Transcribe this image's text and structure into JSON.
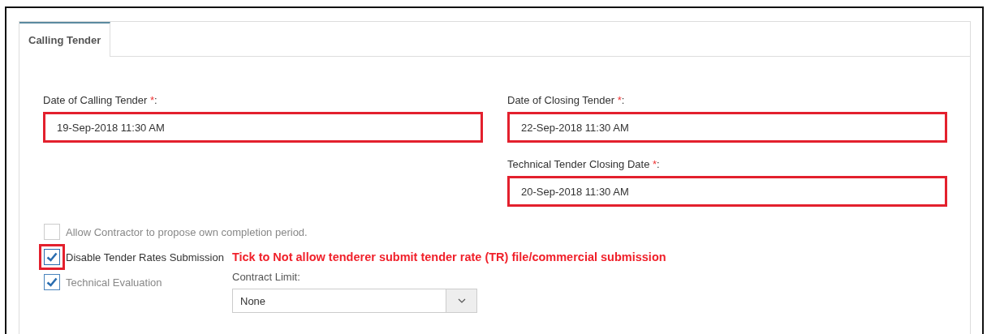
{
  "tabs": [
    {
      "label": "Calling Tender",
      "selected": true
    }
  ],
  "fields": [
    {
      "label": "Date of Calling Tender",
      "required_mark": "*",
      "suffix": ":",
      "value": "19-Sep-2018 11:30 AM",
      "highlighted": true
    },
    {
      "label": "Date of Closing Tender",
      "required_mark": "*",
      "suffix": ":",
      "value": "22-Sep-2018 11:30 AM",
      "highlighted": true
    },
    {
      "label": "Technical Tender Closing Date",
      "required_mark": "*",
      "suffix": ":",
      "value": "20-Sep-2018 11:30 AM",
      "highlighted": true
    }
  ],
  "checkboxes": [
    {
      "label": "Allow Contractor to propose own completion period.",
      "checked": false,
      "disabled": true,
      "highlighted": false
    },
    {
      "label": "Disable Tender Rates Submission",
      "checked": true,
      "disabled": false,
      "highlighted": true,
      "note": "Tick to Not allow tenderer submit tender rate (TR) file/commercial submission"
    },
    {
      "label": "Technical Evaluation",
      "checked": true,
      "disabled": true,
      "highlighted": false
    }
  ],
  "contract_limit": {
    "label": "Contract Limit:",
    "value": "None"
  }
}
